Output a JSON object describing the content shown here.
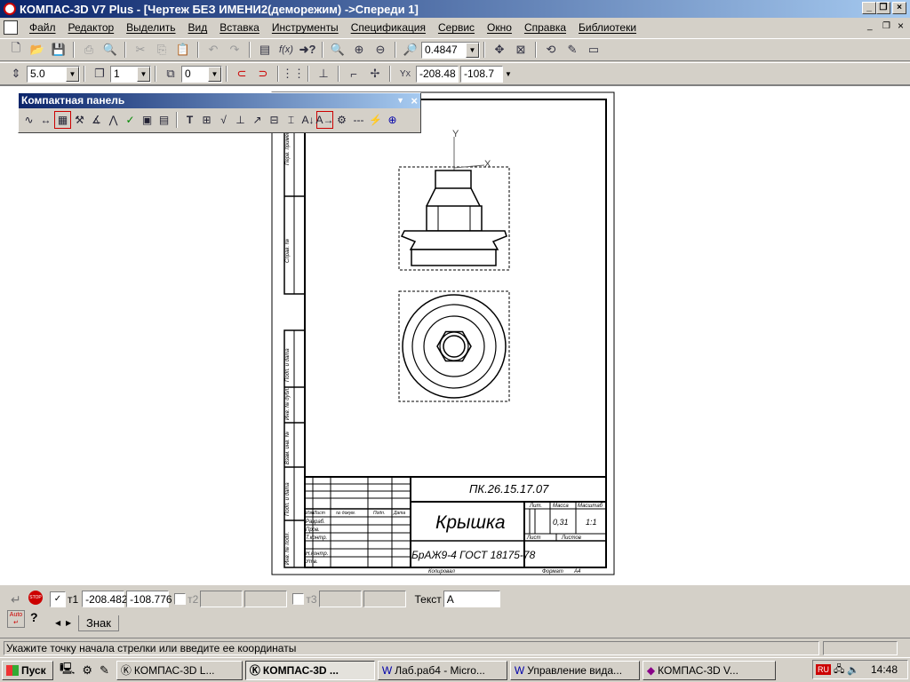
{
  "window": {
    "title": "КОМПАС-3D V7 Plus - [Чертеж БЕЗ ИМЕНИ2(деморежим) ->Спереди 1]"
  },
  "menu": [
    "Файл",
    "Редактор",
    "Выделить",
    "Вид",
    "Вставка",
    "Инструменты",
    "Спецификация",
    "Сервис",
    "Окно",
    "Справка",
    "Библиотеки"
  ],
  "toolbar1": {
    "zoom_value": "0.4847"
  },
  "toolbar2": {
    "step": "5.0",
    "layer": "1",
    "style": "0",
    "coord_x": "-208.48",
    "coord_y": "-108.7"
  },
  "compact_panel": {
    "title": "Компактная панель"
  },
  "drawing": {
    "designation": "ПК.26.15.17.07",
    "name": "Крышка",
    "material": "БрАЖ9-4  ГОСТ 18175-78",
    "mass": "0,31",
    "scale": "1:1",
    "lit_label": "Лит.",
    "mass_label": "Масса",
    "scale_label": "Масштаб",
    "sheet_label": "Лист",
    "sheets_label": "Листов",
    "copied_label": "Копировал",
    "format_label": "Формат",
    "format_value": "A4",
    "axis_y": "Y",
    "axis_x": "X",
    "rows": [
      "Разраб.",
      "Пров.",
      "Т.контр.",
      "Н.контр.",
      "Утв."
    ],
    "header": [
      "Изм.",
      "Лист",
      "№ докум.",
      "Подп.",
      "Дата"
    ],
    "side_labels": [
      "Перв. примен.",
      "Справ. №",
      "Подп. и дата",
      "Инв. № дубл.",
      "Взам. инв. №",
      "Подп. и дата",
      "Инв. № подл."
    ]
  },
  "property_bar": {
    "t1_label": "т1",
    "t1_x": "-208.482",
    "t1_y": "-108.776",
    "t2_label": "т2",
    "t3_label": "т3",
    "text_label": "Текст",
    "text_value": "А",
    "tab_label": "Знак"
  },
  "status": {
    "message": "Укажите точку начала стрелки или введите ее координаты"
  },
  "taskbar": {
    "start": "Пуск",
    "tasks": [
      "КОМПАС-3D L...",
      "КОМПАС-3D ...",
      "Лаб.раб4 - Micro...",
      "Управление вида...",
      "КОМПАС-3D V..."
    ],
    "lang": "RU",
    "clock": "14:48"
  }
}
